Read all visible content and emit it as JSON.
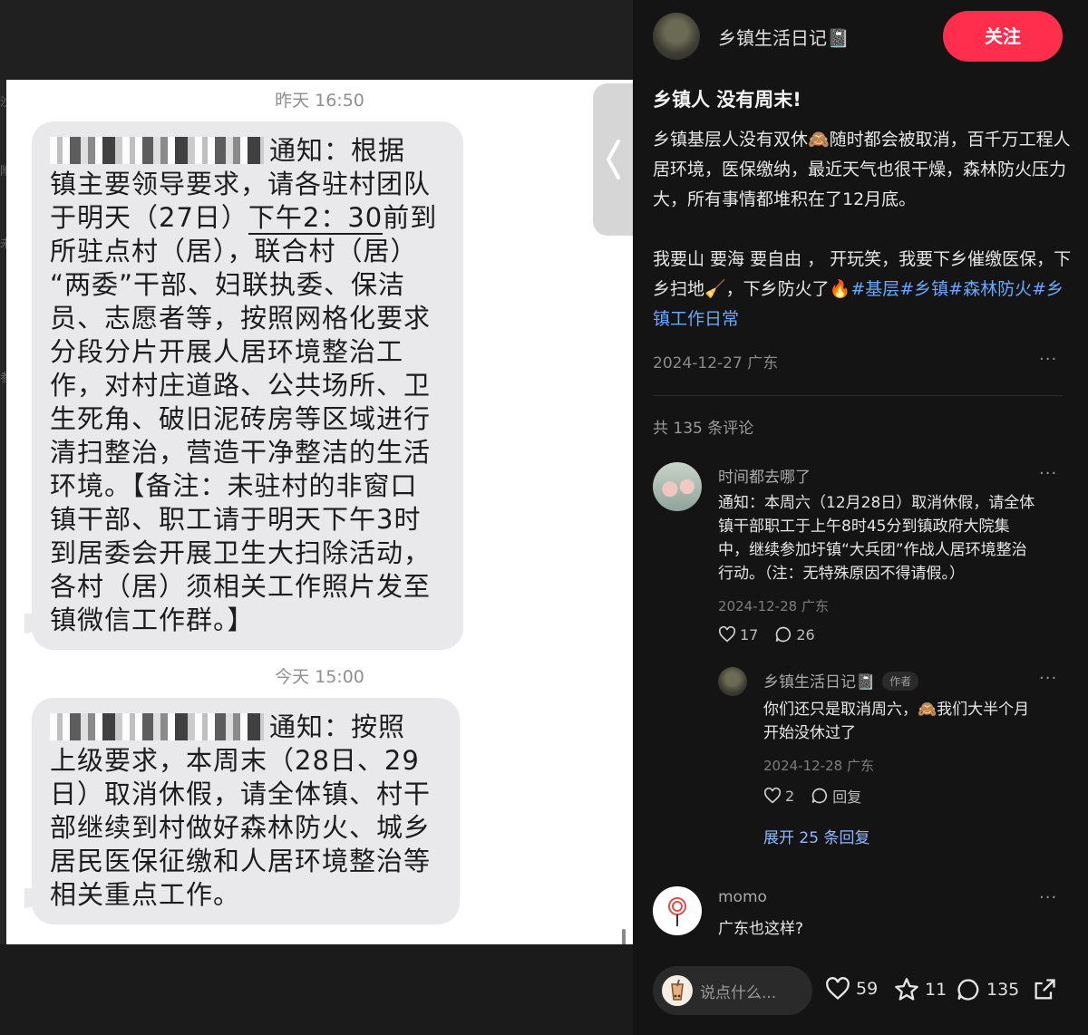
{
  "sms": {
    "time_yesterday": "昨天 16:50",
    "msg1_intro": "通知：根据",
    "msg1_lines": [
      "镇主要领导要求，请各驻村团队",
      "于明天（27日）下午2：30前到",
      "所驻点村（居），联合村（居）",
      "“两委”干部、妇联执委、保洁",
      "员、志愿者等，按照网格化要求",
      "分段分片开展人居环境整治工",
      "作，对村庄道路、公共场所、卫",
      "生死角、破旧泥砖房等区域进行",
      "清扫整治，营造干净整洁的生活",
      "环境。【备注：未驻村的非窗口",
      "镇干部、职工请于明天下午3时",
      "到居委会开展卫生大扫除活动，",
      "各村（居）须相关工作照片发至",
      "镇微信工作群。】"
    ],
    "time_today": "今天 15:00",
    "msg2_intro": "通知：按照",
    "msg2_lines": [
      "上级要求，本周末（28日、29",
      "日）取消休假，请全体镇、村干",
      "部继续到村做好森林防火、城乡",
      "居民医保征缴和人居环境整治等",
      "相关重点工作。"
    ]
  },
  "post": {
    "author": "乡镇生活日记📓",
    "follow_label": "关注",
    "title": "乡镇人 没有周末!",
    "body1": "乡镇基层人没有双休🙈随时都会被取消，百千万工程人居环境，医保缴纳，最近天气也很干燥，森林防火压力大，所有事情都堆积在了12月底。",
    "body2_text": "我要山 要海 要自由 ， 开玩笑，我要下乡催缴医保，下乡扫地🧹，下乡防火了🔥",
    "tags": [
      "#基层",
      "#乡镇",
      "#森林防火",
      "#乡镇工作日常"
    ],
    "meta": "2024-12-27 广东",
    "more": "···",
    "comment_count": "共 135 条评论"
  },
  "comments": [
    {
      "user": "时间都去哪了",
      "text_lines": [
        "通知：本周六（12月28日）取消休假，请全体",
        "镇干部职工于上午8时45分到镇政府大院集",
        "中，继续参加圩镇“大兵团”作战人居环境整治",
        "行动。（注：无特殊原因不得请假。）"
      ],
      "meta": "2024-12-28 广东",
      "likes": "17",
      "replies": "26"
    },
    {
      "user": "乡镇生活日记📓",
      "badge": "作者",
      "text_lines": [
        "你们还只是取消周六，🙈我们大半个月",
        "开始没休过了"
      ],
      "meta": "2024-12-28 广东",
      "likes": "2",
      "reply_label": "回复"
    },
    {
      "user": "momo",
      "text_lines": [
        "广东也这样?"
      ]
    }
  ],
  "expand_replies": "展开 25 条回复",
  "bottom_bar": {
    "placeholder": "说点什么...",
    "likes": "59",
    "stars": "11",
    "comments": "135"
  },
  "edge_glyphs": [
    "沙",
    "附",
    "未",
    "参"
  ]
}
